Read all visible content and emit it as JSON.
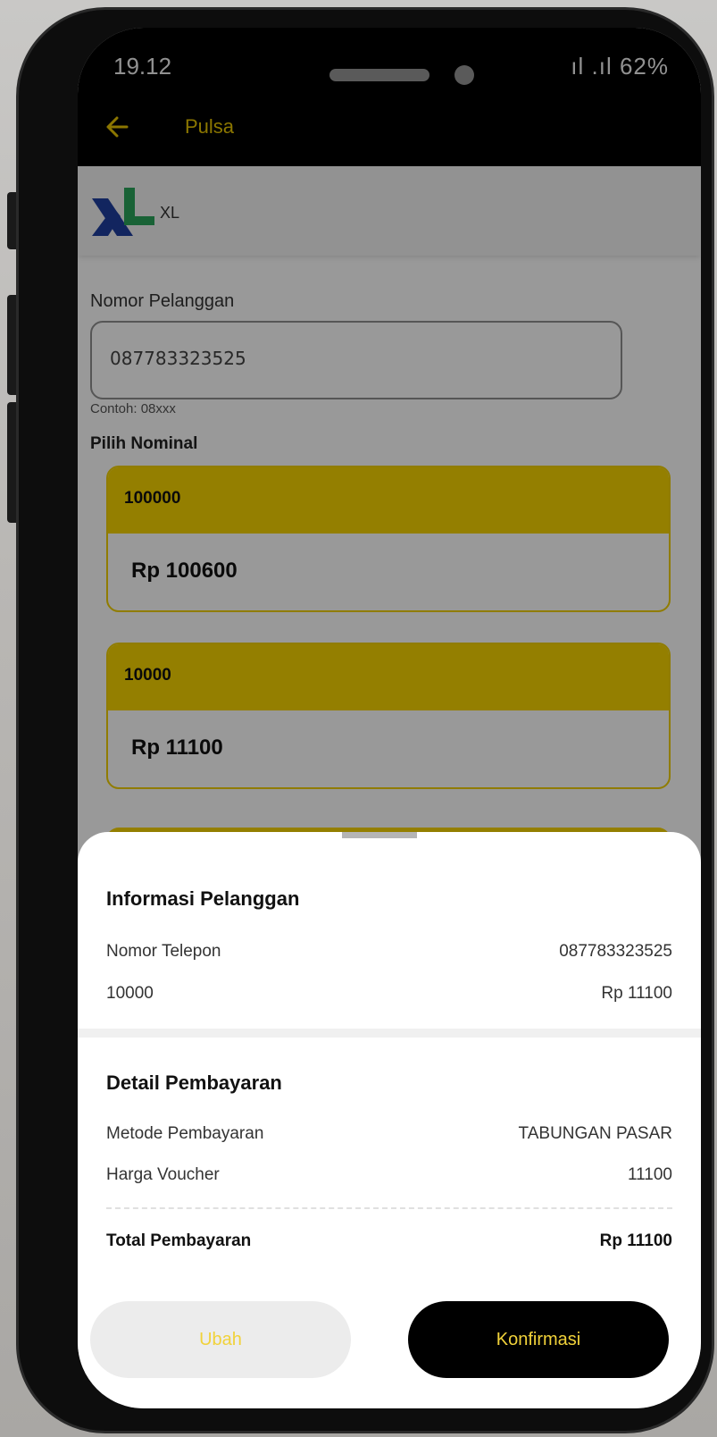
{
  "status_bar": {
    "time": "19.12",
    "right": "ıl .ıl 62%"
  },
  "header": {
    "title": "Pulsa"
  },
  "carrier": {
    "name": "XL"
  },
  "form": {
    "customer_label": "Nomor Pelanggan",
    "phone_value": "087783323525",
    "hint": "Contoh: 08xxx",
    "nominal_label": "Pilih Nominal"
  },
  "nominals": [
    {
      "label": "100000",
      "price": "Rp 100600"
    },
    {
      "label": "10000",
      "price": "Rp 11100"
    }
  ],
  "sheet": {
    "customer_title": "Informasi Pelanggan",
    "phone_label": "Nomor Telepon",
    "phone_value": "087783323525",
    "product_label": "10000",
    "product_price": "Rp 11100",
    "payment_title": "Detail Pembayaran",
    "method_label": "Metode Pembayaran",
    "method_value": "TABUNGAN PASAR",
    "voucher_label": "Harga Voucher",
    "voucher_value": "11100",
    "total_label": "Total Pembayaran",
    "total_value": "Rp 11100",
    "edit_button": "Ubah",
    "confirm_button": "Konfirmasi"
  },
  "colors": {
    "accent": "#f7d400",
    "dark": "#000000"
  }
}
